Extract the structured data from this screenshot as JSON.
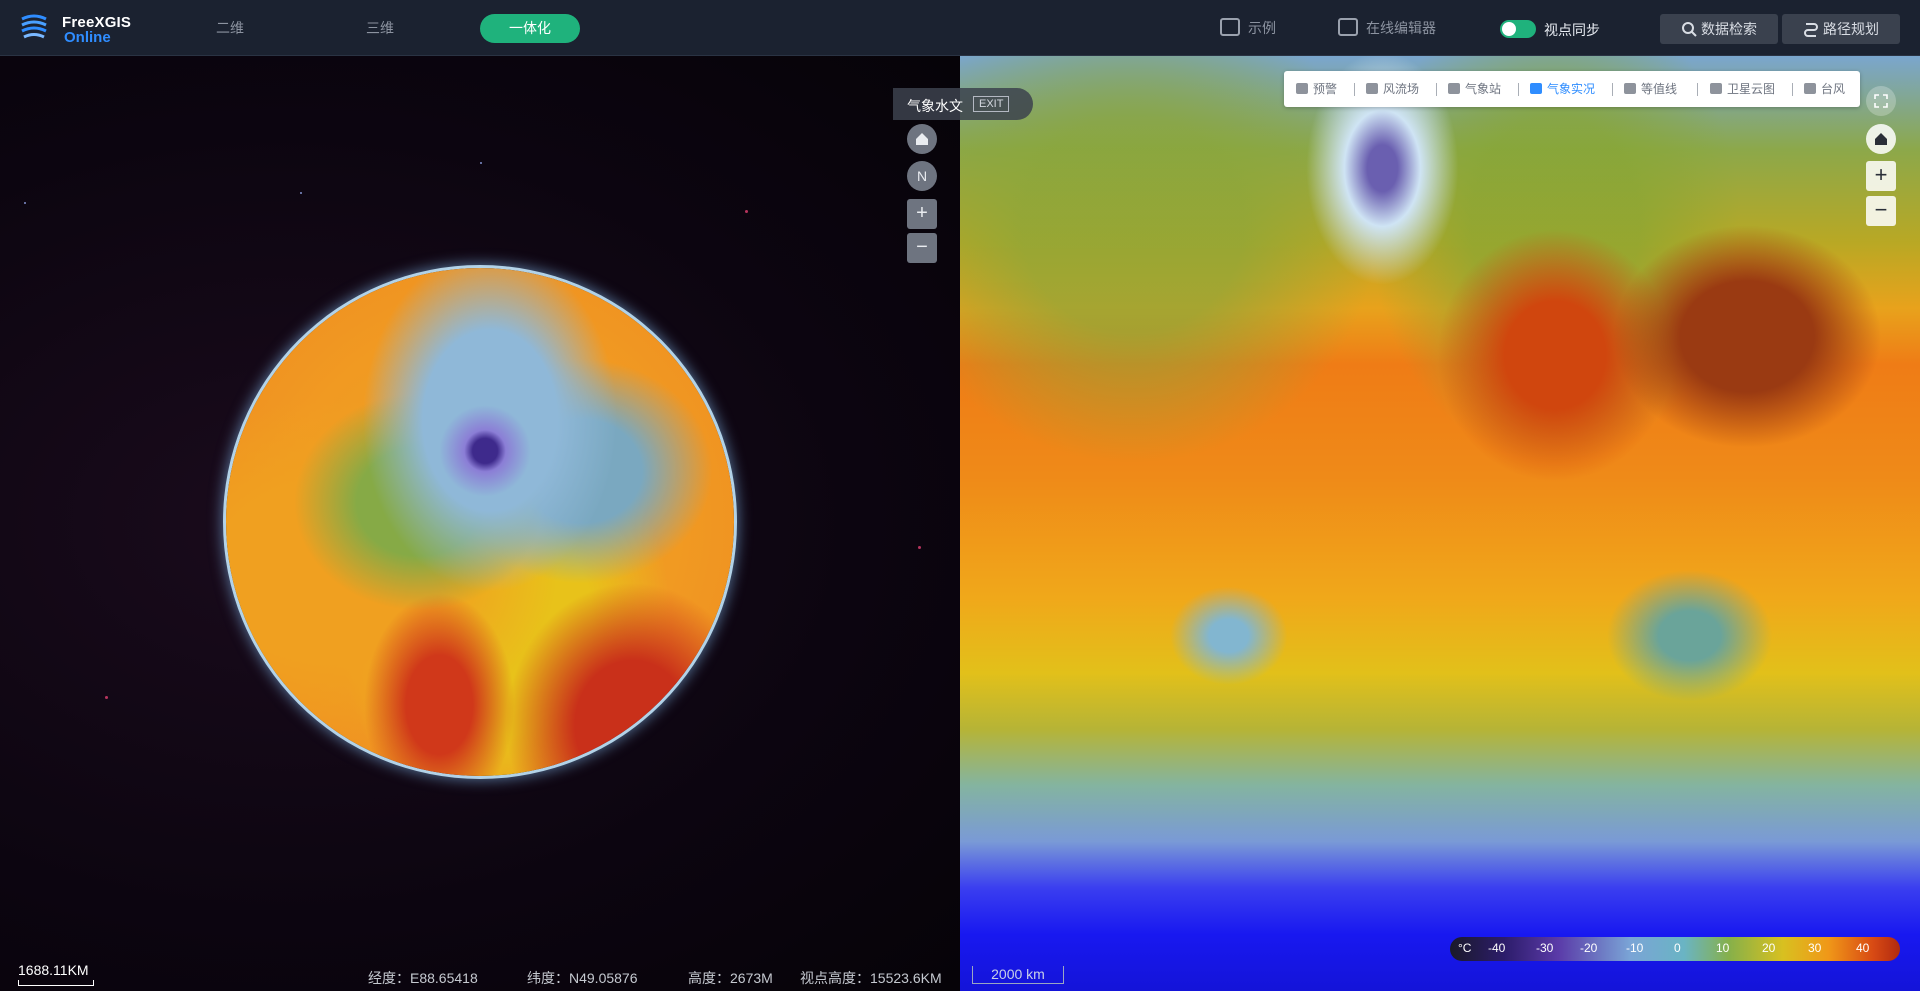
{
  "app": {
    "logo_line1": "FreeXGIS",
    "logo_line2": "Online"
  },
  "mode_tabs": [
    {
      "label": "二维",
      "active": false
    },
    {
      "label": "三维",
      "active": false
    },
    {
      "label": "一体化",
      "active": true
    }
  ],
  "toolbar": {
    "example_label": "示例",
    "editor_label": "在线编辑器",
    "sync_label": "视点同步",
    "sync_on": true,
    "data_search_label": "数据检索",
    "route_label": "路径规划"
  },
  "left_map": {
    "hydro_tag": "气象水文",
    "exit_label": "EXIT",
    "zoom_in": "+",
    "zoom_out": "−",
    "compass_letter": "N",
    "scale_text": "1688.11KM"
  },
  "status": {
    "lon": "经度：E88.65418",
    "lat": "纬度：N49.05876",
    "height": "高度：2673M",
    "view_height": "视点高度：15523.6KM"
  },
  "right_map": {
    "layers": [
      {
        "label": "预警",
        "icon": "alarm-icon",
        "active": false
      },
      {
        "label": "风流场",
        "icon": "wind-icon",
        "active": false
      },
      {
        "label": "气象站",
        "icon": "station-icon",
        "active": false
      },
      {
        "label": "气象实况",
        "icon": "weather-live-icon",
        "active": true
      },
      {
        "label": "等值线",
        "icon": "contour-icon",
        "active": false
      },
      {
        "label": "卫星云图",
        "icon": "satellite-icon",
        "active": false
      },
      {
        "label": "台风",
        "icon": "typhoon-icon",
        "active": false
      }
    ],
    "zoom_in": "+",
    "zoom_out": "−",
    "scale_text": "2000 km",
    "legend": {
      "unit": "°C",
      "ticks": [
        "-40",
        "-30",
        "-20",
        "-10",
        "0",
        "10",
        "20",
        "30",
        "40"
      ]
    }
  },
  "colors": {
    "accent": "#1fb27c",
    "brand_blue": "#2f8dff",
    "topbar": "#1b2230"
  }
}
